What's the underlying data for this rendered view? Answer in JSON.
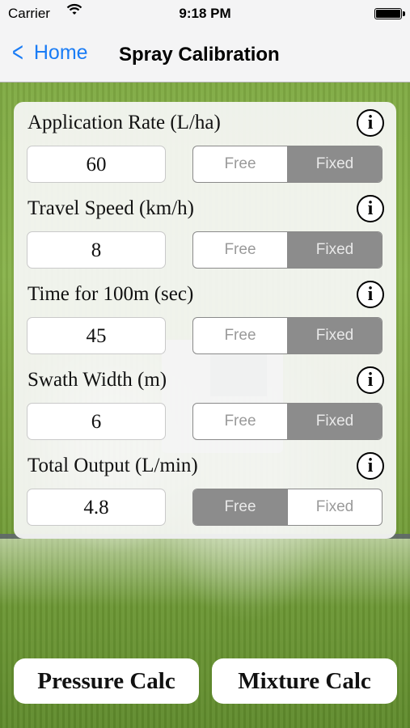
{
  "status_bar": {
    "carrier": "Carrier",
    "time": "9:18 PM",
    "wifi_icon": "wifi-icon",
    "battery_icon": "battery-icon"
  },
  "nav": {
    "back_label": "Home",
    "title": "Spray Calibration",
    "accent_color": "#1a7cf5"
  },
  "rows": [
    {
      "label": "Application Rate (L/ha)",
      "value": "60",
      "free_label": "Free",
      "fixed_label": "Fixed",
      "selected": "Fixed"
    },
    {
      "label": "Travel Speed (km/h)",
      "value": "8",
      "free_label": "Free",
      "fixed_label": "Fixed",
      "selected": "Fixed"
    },
    {
      "label": "Time for 100m (sec)",
      "value": "45",
      "free_label": "Free",
      "fixed_label": "Fixed",
      "selected": "Fixed"
    },
    {
      "label": "Swath Width (m)",
      "value": "6",
      "free_label": "Free",
      "fixed_label": "Fixed",
      "selected": "Fixed"
    },
    {
      "label": "Total Output (L/min)",
      "value": "4.8",
      "free_label": "Free",
      "fixed_label": "Fixed",
      "selected": "Free"
    }
  ],
  "info_glyph": "i",
  "buttons": {
    "pressure_calc": "Pressure Calc",
    "mixture_calc": "Mixture Calc"
  }
}
